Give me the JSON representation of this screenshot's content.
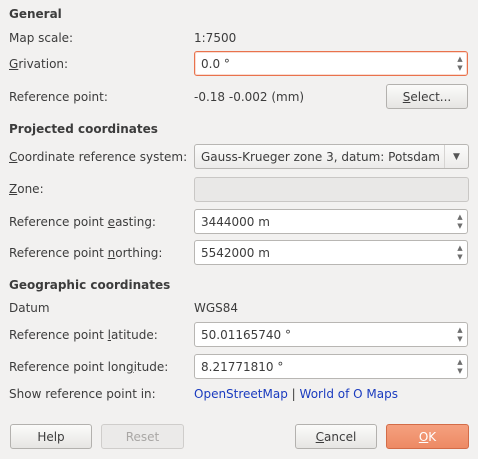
{
  "general": {
    "section_title": "General",
    "map_scale_label": "Map scale:",
    "map_scale_value": "1:7500",
    "grivation_label_first": "G",
    "grivation_label_rest": "rivation:",
    "grivation_value": "0.0 °",
    "ref_point_label": "Reference point:",
    "ref_point_value": "-0.18 -0.002 (mm)",
    "select_button_first": "S",
    "select_button_rest": "elect..."
  },
  "projected": {
    "section_title": "Projected coordinates",
    "crs_label_first": "C",
    "crs_label_rest": "oordinate reference system:",
    "crs_value": "Gauss-Krueger zone 3, datum: Potsdam",
    "zone_label_first": "Z",
    "zone_label_rest": "one:",
    "zone_value": "",
    "easting_label_pre": "Reference point ",
    "easting_label_first": "e",
    "easting_label_rest": "asting:",
    "easting_value": "3444000 m",
    "northing_label_pre": "Reference point ",
    "northing_label_first": "n",
    "northing_label_rest": "orthing:",
    "northing_value": "5542000 m"
  },
  "geographic": {
    "section_title": "Geographic coordinates",
    "datum_label": "Datum",
    "datum_value": "WGS84",
    "latitude_label_pre": "Reference point ",
    "latitude_label_first": "l",
    "latitude_label_rest": "atitude:",
    "latitude_value": "50.01165740 °",
    "longitude_label_pre": "Reference point lon",
    "longitude_label_first": "g",
    "longitude_label_rest": "itude:",
    "longitude_value": "8.21771810 °",
    "show_in_label": "Show reference point in:",
    "link_osm": "OpenStreetMap",
    "link_separator": "|",
    "link_woom": "World of O Maps"
  },
  "buttons": {
    "help": "Help",
    "reset": "Reset",
    "cancel_first": "C",
    "cancel_rest": "ancel",
    "ok_first": "O",
    "ok_rest": "K"
  },
  "icons": {
    "spin_up": "▲",
    "spin_down": "▼",
    "combo": "▼"
  },
  "colors": {
    "accent": "#ed8a64",
    "focus_border": "#e9724c",
    "link": "#1a3bbf"
  }
}
